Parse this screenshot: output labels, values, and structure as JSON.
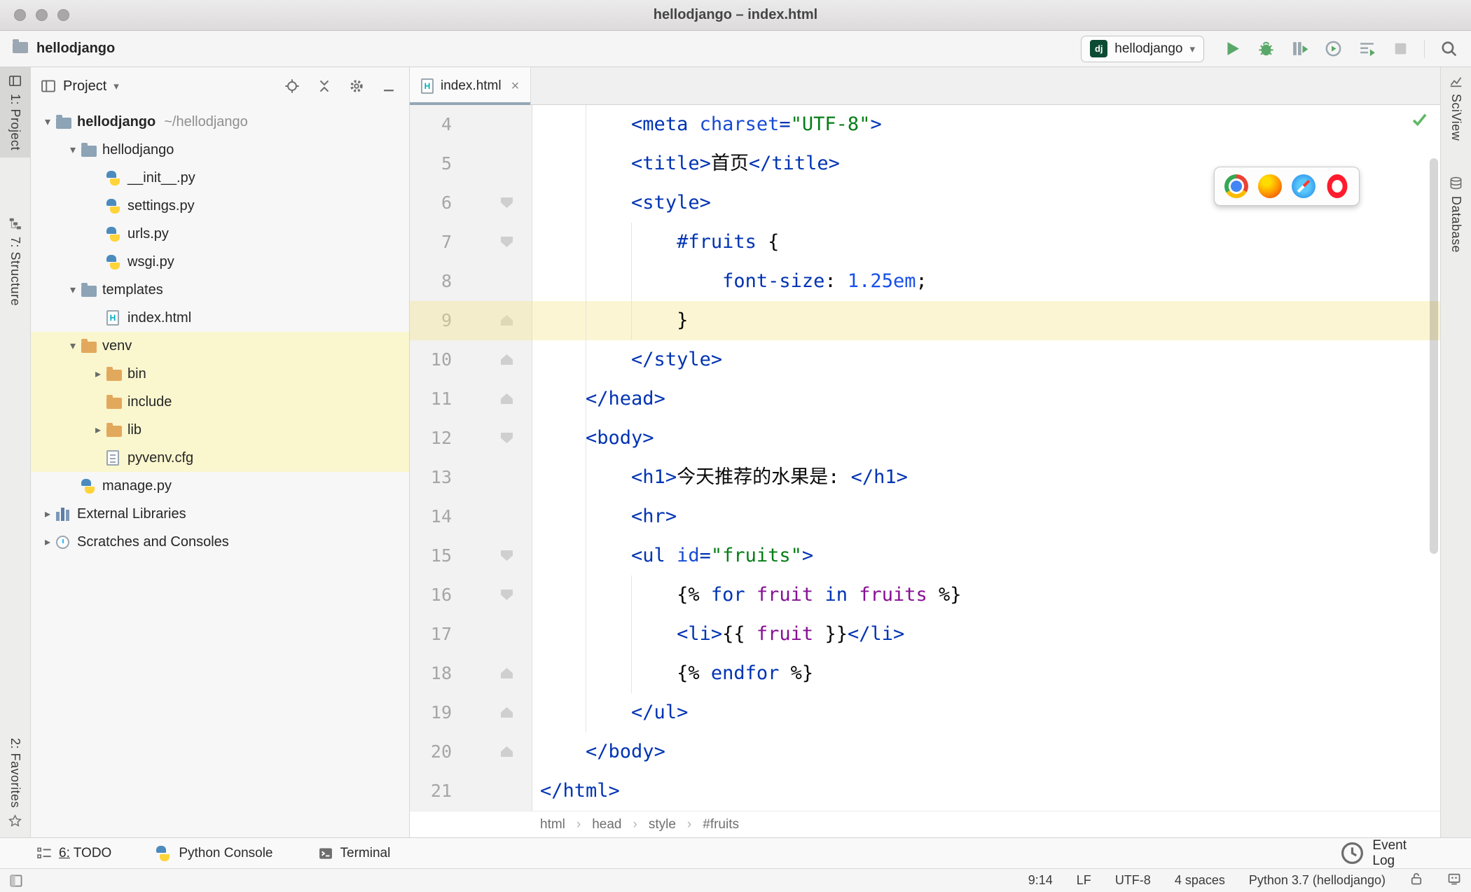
{
  "window": {
    "title": "hellodjango – index.html"
  },
  "toolbar": {
    "project_name": "hellodjango",
    "run_config": {
      "label": "hellodjango",
      "icon_text": "dj"
    }
  },
  "stripes": {
    "left": [
      {
        "label": "1: Project"
      },
      {
        "label": "7: Structure"
      },
      {
        "label": "2: Favorites"
      }
    ],
    "right": [
      {
        "label": "SciView"
      },
      {
        "label": "Database"
      }
    ]
  },
  "project_panel": {
    "title": "Project",
    "tree": [
      {
        "label": "hellodjango",
        "hint": "~/hellodjango",
        "level": 0,
        "arrow": "expanded",
        "icon": "folder",
        "bold": true
      },
      {
        "label": "hellodjango",
        "level": 1,
        "arrow": "expanded",
        "icon": "folder"
      },
      {
        "label": "__init__.py",
        "level": 2,
        "icon": "python"
      },
      {
        "label": "settings.py",
        "level": 2,
        "icon": "python"
      },
      {
        "label": "urls.py",
        "level": 2,
        "icon": "python"
      },
      {
        "label": "wsgi.py",
        "level": 2,
        "icon": "python"
      },
      {
        "label": "templates",
        "level": 1,
        "arrow": "expanded",
        "icon": "folder"
      },
      {
        "label": "index.html",
        "level": 2,
        "icon": "html"
      },
      {
        "label": "venv",
        "level": 1,
        "arrow": "expanded",
        "icon": "folder-excluded",
        "highlight": true
      },
      {
        "label": "bin",
        "level": 2,
        "arrow": "collapsed",
        "icon": "folder-excluded",
        "highlight": true
      },
      {
        "label": "include",
        "level": 2,
        "icon": "folder-excluded",
        "highlight": true
      },
      {
        "label": "lib",
        "level": 2,
        "arrow": "collapsed",
        "icon": "folder-excluded",
        "highlight": true
      },
      {
        "label": "pyvenv.cfg",
        "level": 2,
        "icon": "config",
        "highlight": true
      },
      {
        "label": "manage.py",
        "level": 1,
        "icon": "python"
      },
      {
        "label": "External Libraries",
        "level": 0,
        "arrow": "collapsed",
        "icon": "libraries"
      },
      {
        "label": "Scratches and Consoles",
        "level": 0,
        "arrow": "collapsed",
        "icon": "scratches"
      }
    ]
  },
  "editor": {
    "tab": {
      "label": "index.html"
    },
    "breadcrumbs": [
      "html",
      "head",
      "style",
      "#fruits"
    ],
    "browser_popup": [
      "chrome",
      "firefox",
      "safari",
      "opera"
    ],
    "code": {
      "first_line": 4,
      "current_line": 9,
      "fold_markers": {
        "down": [
          6,
          7,
          12,
          15,
          16
        ],
        "up": [
          9,
          10,
          11,
          18,
          19,
          20
        ]
      },
      "lines": [
        {
          "n": 4,
          "seg": [
            [
              "        ",
              "ws"
            ],
            [
              "<meta ",
              "tag"
            ],
            [
              "charset",
              "attr"
            ],
            [
              "=",
              "tag"
            ],
            [
              "\"UTF-8\"",
              "str"
            ],
            [
              ">",
              "tag"
            ]
          ]
        },
        {
          "n": 5,
          "seg": [
            [
              "        ",
              "ws"
            ],
            [
              "<title>",
              "tag"
            ],
            [
              "首页",
              "text"
            ],
            [
              "</title>",
              "tag"
            ]
          ]
        },
        {
          "n": 6,
          "seg": [
            [
              "        ",
              "ws"
            ],
            [
              "<style>",
              "tag"
            ]
          ]
        },
        {
          "n": 7,
          "seg": [
            [
              "            ",
              "ws"
            ],
            [
              "#fruits",
              "csssel"
            ],
            [
              " {",
              "text"
            ]
          ]
        },
        {
          "n": 8,
          "seg": [
            [
              "                ",
              "ws"
            ],
            [
              "font-size",
              "cssprop"
            ],
            [
              ": ",
              "text"
            ],
            [
              "1.25em",
              "cssval"
            ],
            [
              ";",
              "text"
            ]
          ]
        },
        {
          "n": 9,
          "seg": [
            [
              "            ",
              "ws"
            ],
            [
              "}",
              "text"
            ]
          ]
        },
        {
          "n": 10,
          "seg": [
            [
              "        ",
              "ws"
            ],
            [
              "</style>",
              "tag"
            ]
          ]
        },
        {
          "n": 11,
          "seg": [
            [
              "    ",
              "ws"
            ],
            [
              "</head>",
              "tag"
            ]
          ]
        },
        {
          "n": 12,
          "seg": [
            [
              "    ",
              "ws"
            ],
            [
              "<body>",
              "tag"
            ]
          ]
        },
        {
          "n": 13,
          "seg": [
            [
              "        ",
              "ws"
            ],
            [
              "<h1>",
              "tag"
            ],
            [
              "今天推荐的水果是: ",
              "text"
            ],
            [
              "</h1>",
              "tag"
            ]
          ]
        },
        {
          "n": 14,
          "seg": [
            [
              "        ",
              "ws"
            ],
            [
              "<hr>",
              "tag"
            ]
          ]
        },
        {
          "n": 15,
          "seg": [
            [
              "        ",
              "ws"
            ],
            [
              "<ul ",
              "tag"
            ],
            [
              "id",
              "attr"
            ],
            [
              "=",
              "tag"
            ],
            [
              "\"fruits\"",
              "str"
            ],
            [
              ">",
              "tag"
            ]
          ]
        },
        {
          "n": 16,
          "seg": [
            [
              "            ",
              "ws"
            ],
            [
              "{% ",
              "brace"
            ],
            [
              "for ",
              "kw"
            ],
            [
              "fruit ",
              "var"
            ],
            [
              "in ",
              "kw"
            ],
            [
              "fruits ",
              "var"
            ],
            [
              "%}",
              "brace"
            ]
          ]
        },
        {
          "n": 17,
          "seg": [
            [
              "            ",
              "ws"
            ],
            [
              "<li>",
              "tag"
            ],
            [
              "{{ ",
              "brace"
            ],
            [
              "fruit ",
              "var"
            ],
            [
              "}}",
              "brace"
            ],
            [
              "</li>",
              "tag"
            ]
          ]
        },
        {
          "n": 18,
          "seg": [
            [
              "            ",
              "ws"
            ],
            [
              "{% ",
              "brace"
            ],
            [
              "endfor ",
              "kw"
            ],
            [
              "%}",
              "brace"
            ]
          ]
        },
        {
          "n": 19,
          "seg": [
            [
              "        ",
              "ws"
            ],
            [
              "</ul>",
              "tag"
            ]
          ]
        },
        {
          "n": 20,
          "seg": [
            [
              "    ",
              "ws"
            ],
            [
              "</body>",
              "tag"
            ]
          ]
        },
        {
          "n": 21,
          "seg": [
            [
              "</html>",
              "tag"
            ]
          ]
        }
      ]
    }
  },
  "bottom_bar": {
    "left": [
      {
        "label": "6: TODO"
      },
      {
        "label": "Python Console"
      },
      {
        "label": "Terminal"
      }
    ],
    "right": [
      {
        "label": "Event Log"
      }
    ]
  },
  "status_bar": {
    "caret": "9:14",
    "line_ending": "LF",
    "encoding": "UTF-8",
    "indent": "4 spaces",
    "interpreter": "Python 3.7 (hellodjango)"
  },
  "colors": {
    "tag": "#0033B3",
    "attribute": "#174AD4",
    "string": "#067D17",
    "keyword": "#0033B3",
    "variable": "#871094",
    "css_value": "#1750EB",
    "plain": "#080808",
    "current_line_bg": "#FAF3DC",
    "excluded_bg": "#FAF6CE",
    "run_green": "#59A869",
    "django_green": "#0C4B33"
  },
  "icons": {
    "chevron_down": "▾",
    "chevron_right": "▸",
    "close": "×",
    "breadcrumb_sep": "›"
  }
}
